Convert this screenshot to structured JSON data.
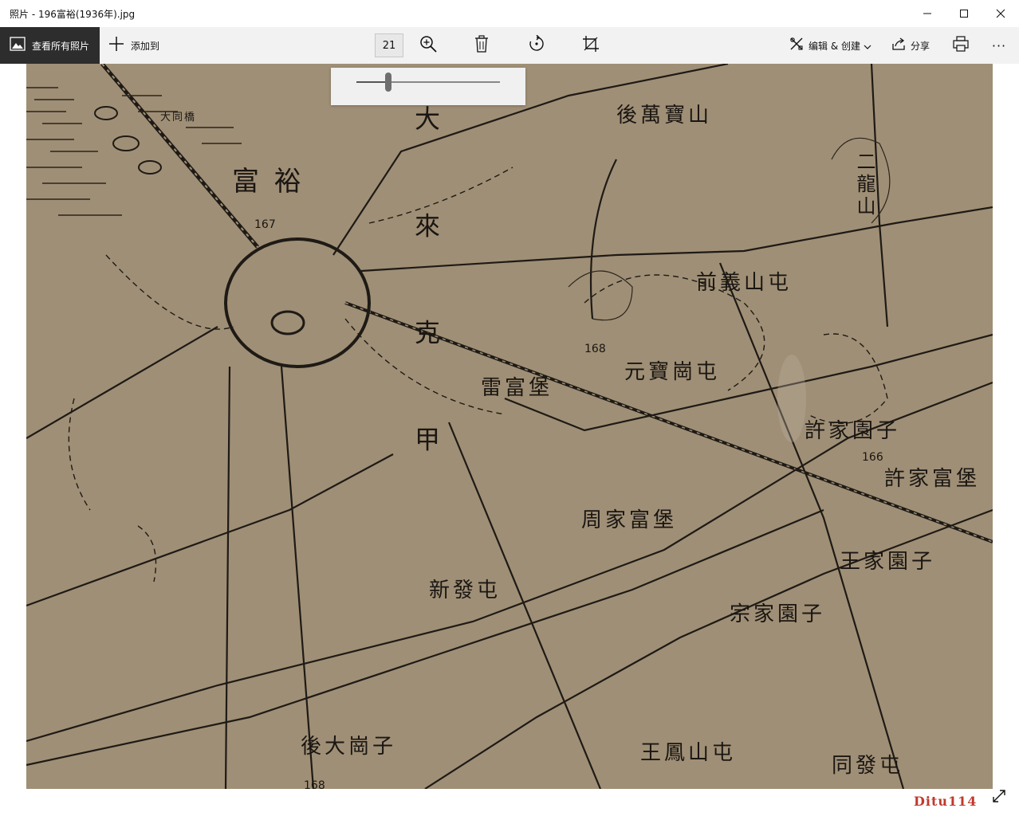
{
  "window": {
    "title": "照片 - 196富裕(1936年).jpg",
    "minimize_icon": "minimize-icon",
    "maximize_icon": "maximize-icon",
    "close_icon": "close-icon"
  },
  "toolbar": {
    "all_photos_label": "查看所有照片",
    "add_to_label": "添加到",
    "zoom_value": "21",
    "edit_create_label": "编辑 & 创建",
    "share_label": "分享",
    "more_label": "···"
  },
  "zoom_slider": {
    "level": 0.22
  },
  "map": {
    "labels": [
      {
        "id": "fuyu",
        "text": "富 裕"
      },
      {
        "id": "dakeqing",
        "text": "大 來 克 甲"
      },
      {
        "id": "houwanbao",
        "text": "後萬寶山"
      },
      {
        "id": "erlong",
        "text": "二龍山"
      },
      {
        "id": "qianyishan",
        "text": "前義山屯"
      },
      {
        "id": "yuanbao",
        "text": "元寶崗屯"
      },
      {
        "id": "leifu",
        "text": "雷富堡"
      },
      {
        "id": "xujia",
        "text": "許家園子"
      },
      {
        "id": "xujiafu",
        "text": "許家富堡"
      },
      {
        "id": "zhoujia",
        "text": "周家富堡"
      },
      {
        "id": "wangjia",
        "text": "王家園子"
      },
      {
        "id": "xinfa",
        "text": "新發屯"
      },
      {
        "id": "zongjia",
        "text": "宗家園子"
      },
      {
        "id": "houdagang",
        "text": "後大崗子"
      },
      {
        "id": "wangfeng",
        "text": "王鳳山屯"
      },
      {
        "id": "tongfa",
        "text": "同發屯"
      },
      {
        "id": "dajiaoqiao",
        "text": "大同橋"
      }
    ],
    "elevations": [
      "167",
      "168",
      "166",
      "168"
    ]
  },
  "watermark": "Ditu114"
}
